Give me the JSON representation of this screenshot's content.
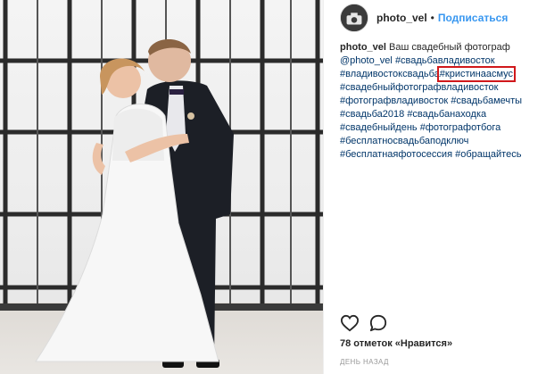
{
  "post": {
    "username": "photo_vel",
    "separator": "•",
    "follow_label": "Подписаться",
    "caption": {
      "username": "photo_vel",
      "text": "Ваш свадебный фотограф",
      "mention": "@photo_vel",
      "tags": [
        "#свадьбавладивосток",
        "#владивостоксвадьба",
        "#кристинаасмус",
        "#свадебныйфотографвладивосток",
        "#фотографвладивосток",
        "#свадьбамечты",
        "#свадьба2018",
        "#свадьбанаходка",
        "#свадебныйдень",
        "#фотографотбога",
        "#бесплатносвадьбаподключ",
        "#бесплатнаяфотосессия",
        "#обращайтесь"
      ],
      "highlighted_tag": "#кристинаасмус"
    },
    "likes_text": "78 отметок «Нравится»",
    "timestamp": "ДЕНЬ НАЗАД"
  },
  "icons": {
    "like": "heart-icon",
    "comment": "comment-icon"
  },
  "colors": {
    "link": "#003569",
    "follow": "#3897f0",
    "highlight_box": "#d0181b",
    "muted": "#999999"
  }
}
